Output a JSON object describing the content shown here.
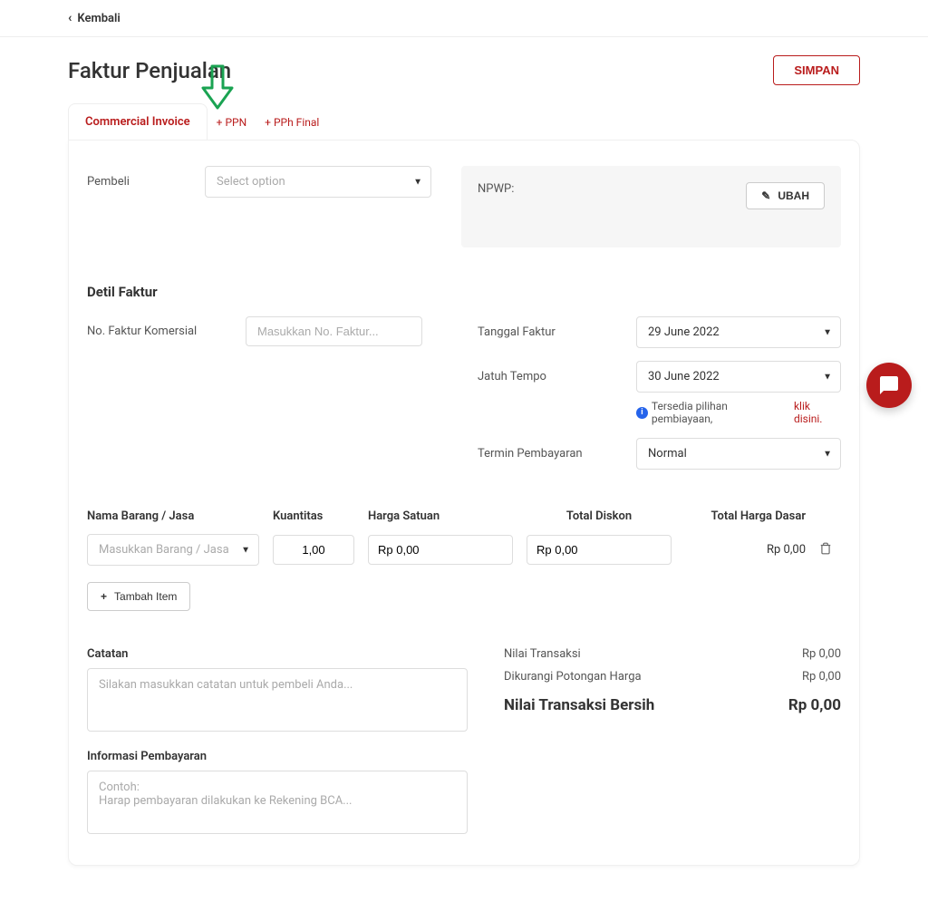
{
  "top": {
    "back": "Kembali"
  },
  "page": {
    "title": "Faktur Penjualan",
    "save": "SIMPAN"
  },
  "tabs": {
    "main": "Commercial Invoice",
    "ppn": "+ PPN",
    "pph": "+ PPh Final"
  },
  "buyer": {
    "label": "Pembeli",
    "placeholder": "Select option"
  },
  "npwp": {
    "label": "NPWP:",
    "ubah": "UBAH"
  },
  "detail": {
    "title": "Detil Faktur",
    "no_label": "No. Faktur Komersial",
    "no_placeholder": "Masukkan No. Faktur...",
    "tanggal_label": "Tanggal Faktur",
    "tanggal_value": "29 June 2022",
    "jatuh_label": "Jatuh Tempo",
    "jatuh_value": "30 June 2022",
    "info_text": "Tersedia pilihan pembiayaan, ",
    "info_link": "klik disini.",
    "termin_label": "Termin Pembayaran",
    "termin_value": "Normal"
  },
  "table": {
    "headers": {
      "nama": "Nama Barang / Jasa",
      "kuantitas": "Kuantitas",
      "harga": "Harga Satuan",
      "diskon": "Total Diskon",
      "total": "Total Harga Dasar"
    },
    "row": {
      "nama_placeholder": "Masukkan Barang / Jasa",
      "kuantitas": "1,00",
      "harga": "Rp 0,00",
      "diskon": "Rp 0,00",
      "total": "Rp 0,00"
    },
    "tambah": "Tambah Item"
  },
  "notes": {
    "catatan_label": "Catatan",
    "catatan_ph": "Silakan masukkan catatan untuk pembeli Anda...",
    "info_label": "Informasi Pembayaran",
    "info_ph": "Contoh:\nHarap pembayaran dilakukan ke Rekening BCA..."
  },
  "summary": {
    "nilai": "Nilai Transaksi",
    "nilai_v": "Rp 0,00",
    "potongan": "Dikurangi Potongan Harga",
    "potongan_v": "Rp 0,00",
    "bersih": "Nilai Transaksi Bersih",
    "bersih_v": "Rp 0,00"
  }
}
